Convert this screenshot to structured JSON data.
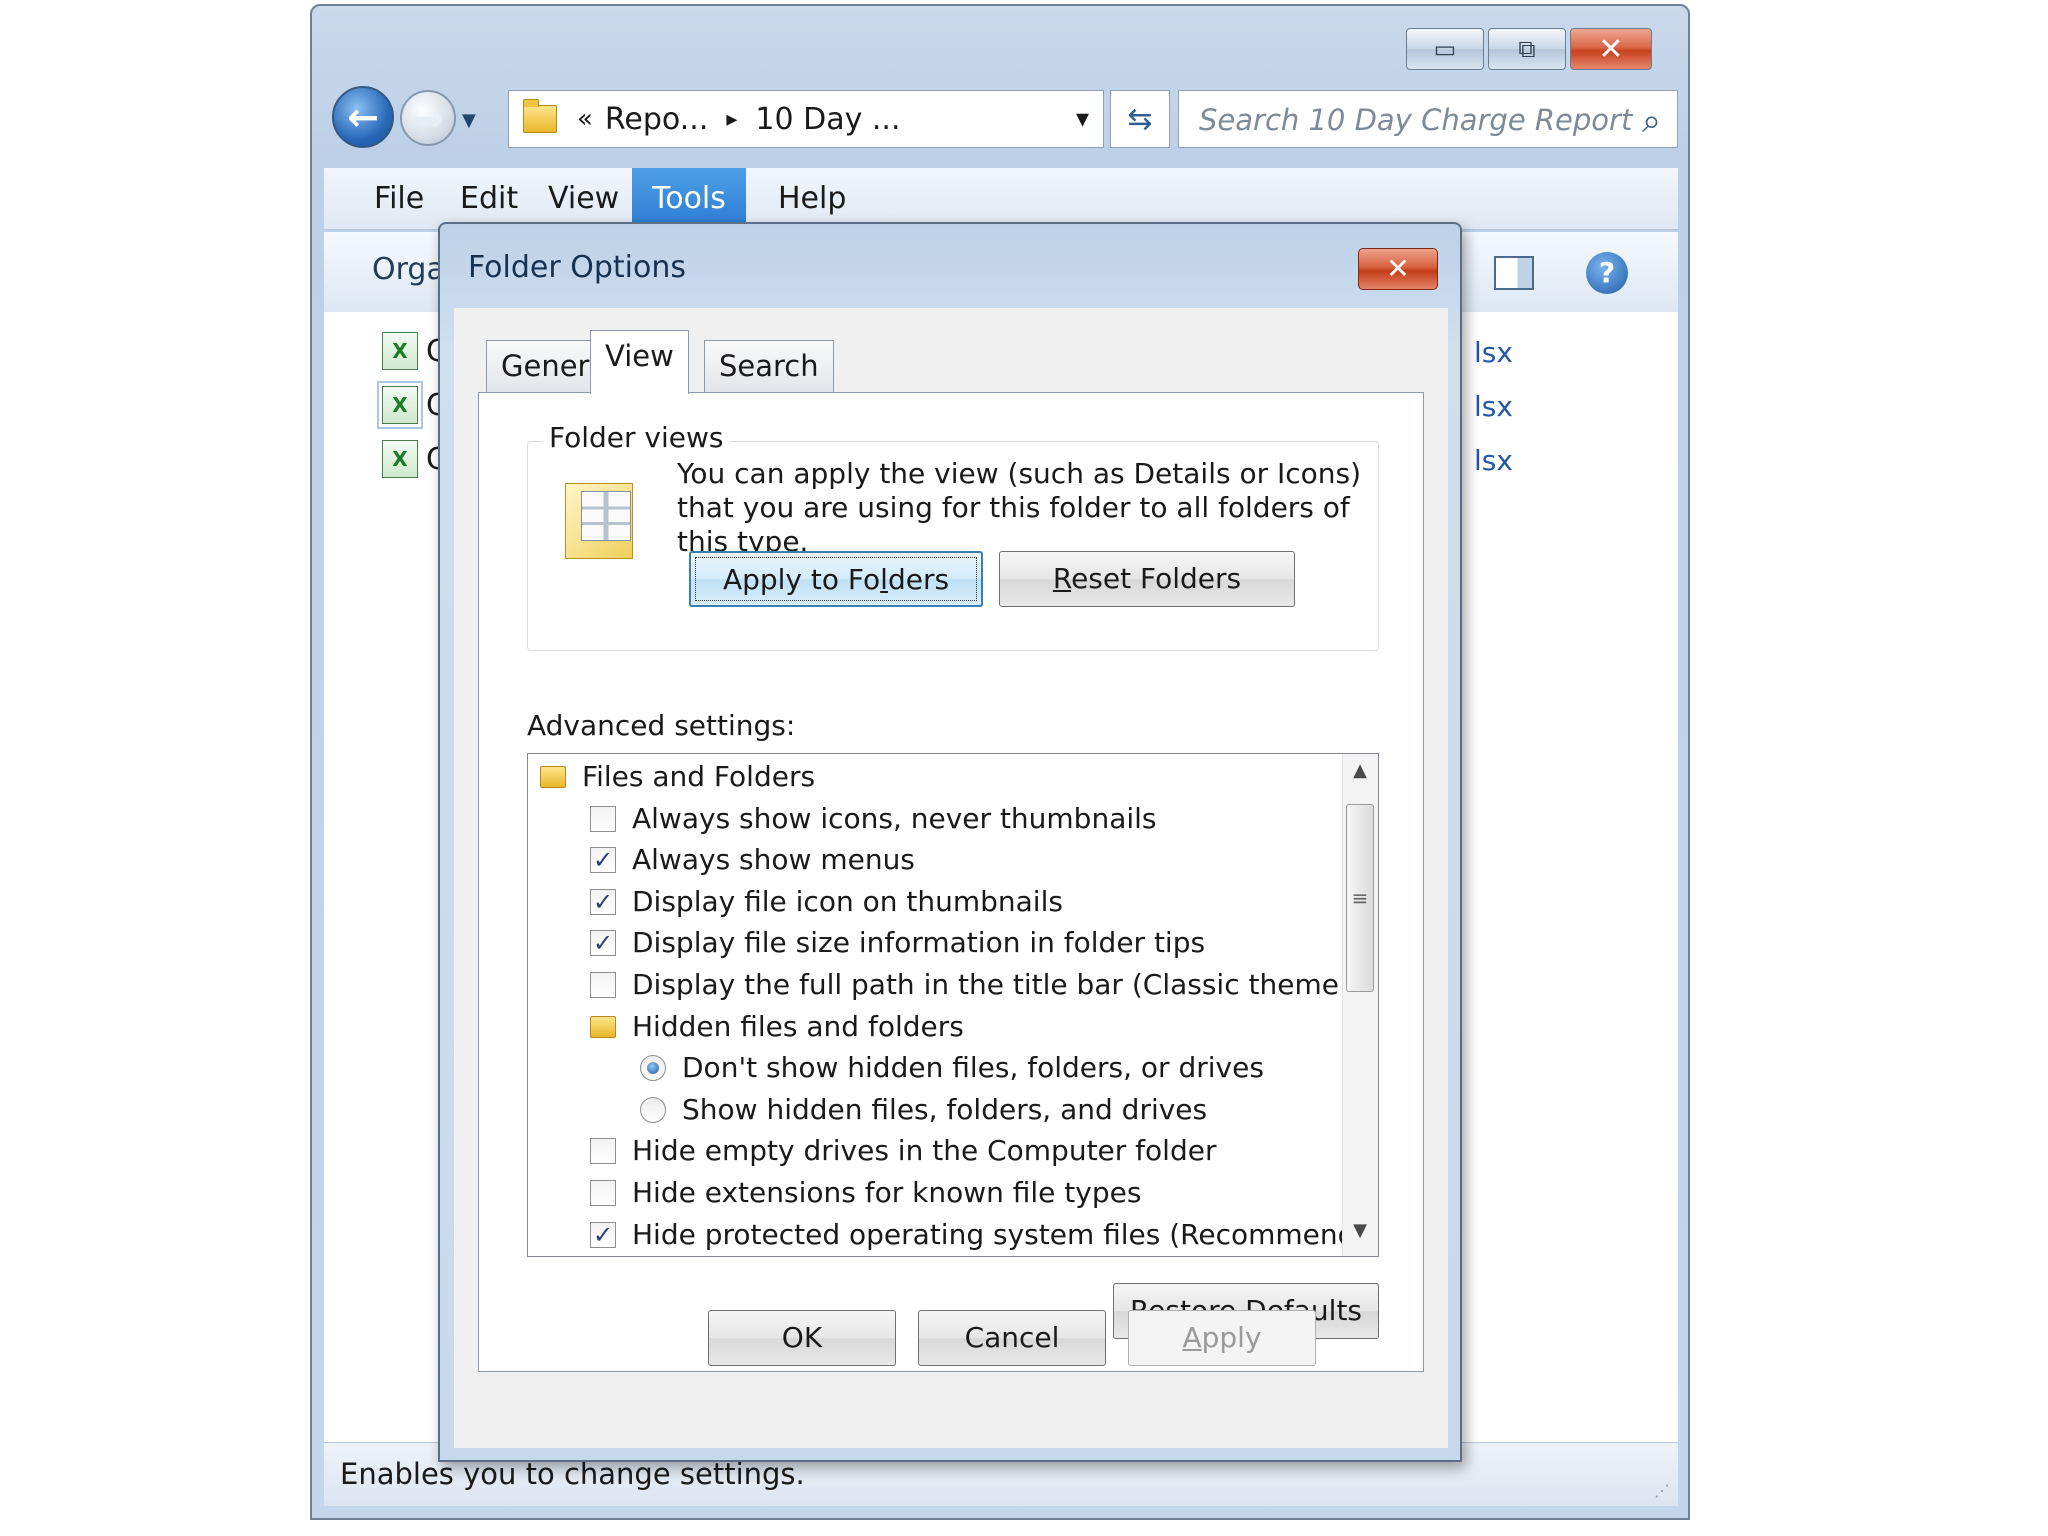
{
  "explorer": {
    "address": {
      "chevrons": "«",
      "crumb1": "Repo...",
      "sep": "▸",
      "crumb2": "10 Day ...",
      "dropdown": "▾"
    },
    "search_placeholder": "Search 10 Day Charge Report",
    "menu": [
      "File",
      "Edit",
      "View",
      "Tools",
      "Help"
    ],
    "active_menu": "Tools",
    "organize_partial": "Orga",
    "files": [
      {
        "name_partial": "C",
        "ext_partial": "lsx"
      },
      {
        "name_partial": "C",
        "ext_partial": "lsx"
      },
      {
        "name_partial": "C",
        "ext_partial": "lsx"
      }
    ],
    "status_text": "Enables you to change settings."
  },
  "dialog": {
    "title": "Folder Options",
    "tabs": [
      "General",
      "View",
      "Search"
    ],
    "active_tab": "View",
    "folder_views": {
      "label": "Folder views",
      "description": "You can apply the view (such as Details or Icons) that you are using for this folder to all folders of this type.",
      "apply_button": {
        "pre": "Apply to Fo",
        "accel": "l",
        "post": "ders"
      },
      "reset_button": {
        "accel": "R",
        "post": "eset Folders"
      }
    },
    "advanced_label": "Advanced settings:",
    "advanced_items": [
      {
        "type": "folder",
        "indent": 0,
        "label": "Files and Folders"
      },
      {
        "type": "checkbox",
        "indent": 1,
        "label": "Always show icons, never thumbnails",
        "checked": false
      },
      {
        "type": "checkbox",
        "indent": 1,
        "label": "Always show menus",
        "checked": true
      },
      {
        "type": "checkbox",
        "indent": 1,
        "label": "Display file icon on thumbnails",
        "checked": true
      },
      {
        "type": "checkbox",
        "indent": 1,
        "label": "Display file size information in folder tips",
        "checked": true
      },
      {
        "type": "checkbox",
        "indent": 1,
        "label": "Display the full path in the title bar (Classic theme only)",
        "checked": false
      },
      {
        "type": "folder",
        "indent": 1,
        "label": "Hidden files and folders"
      },
      {
        "type": "radio",
        "indent": 2,
        "label": "Don't show hidden files, folders, or drives",
        "checked": true
      },
      {
        "type": "radio",
        "indent": 2,
        "label": "Show hidden files, folders, and drives",
        "checked": false
      },
      {
        "type": "checkbox",
        "indent": 1,
        "label": "Hide empty drives in the Computer folder",
        "checked": false
      },
      {
        "type": "checkbox",
        "indent": 1,
        "label": "Hide extensions for known file types",
        "checked": false
      },
      {
        "type": "checkbox",
        "indent": 1,
        "label": "Hide protected operating system files (Recommended)",
        "checked": true
      }
    ],
    "restore_button": {
      "pre": "Restore ",
      "accel": "D",
      "post": "efaults"
    },
    "ok_label": "OK",
    "cancel_label": "Cancel",
    "apply_button": {
      "accel": "A",
      "post": "pply"
    }
  },
  "icons": {
    "back": "←",
    "forward": "→",
    "nav_dropdown": "▼",
    "refresh": "⇆",
    "search": "⌕",
    "minimize": "▭",
    "maximize": "⧉",
    "close": "✕",
    "help": "?",
    "check": "✓",
    "scroll_up": "▲",
    "scroll_down": "▼",
    "scroll_grip": "≡",
    "resize_grip": "⋰",
    "excel": "X"
  },
  "colors": {
    "accent": "#2a7bd3",
    "close_red": "#c7411f",
    "link_blue": "#2457a8"
  }
}
